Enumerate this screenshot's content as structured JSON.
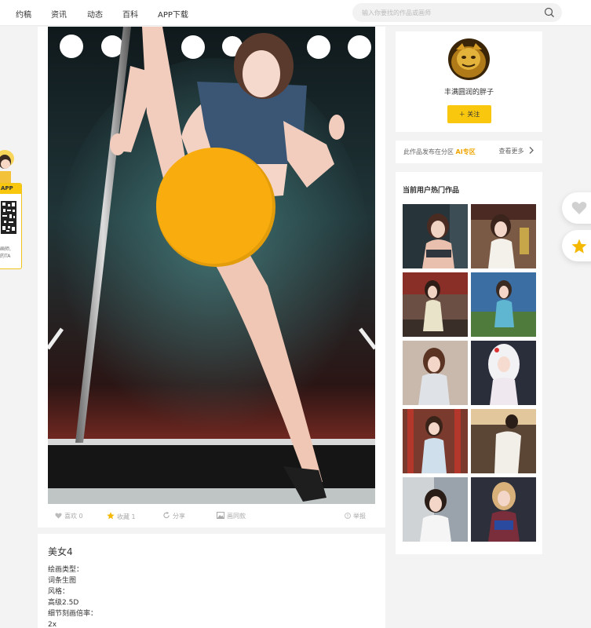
{
  "nav": {
    "items": [
      "约稿",
      "资讯",
      "动态",
      "百科",
      "APP下载"
    ]
  },
  "search": {
    "placeholder": "输入你要找的作品或画师"
  },
  "float_qr": {
    "label": "APP",
    "text_line1": "画师,",
    "text_line2": "的TA"
  },
  "artwork": {
    "censor_color": "#f9ac0e"
  },
  "actions": {
    "like": "喜欢 0",
    "collect": "收藏 1",
    "share": "分享",
    "same": "画同款",
    "report": "举报"
  },
  "description": {
    "title": "美女4",
    "lines": [
      "绘画类型：",
      "词条生图",
      "风格：",
      "高级2.5D",
      "细节刻画倍率：",
      "2x"
    ]
  },
  "author": {
    "name": "丰满圆润的胖子",
    "follow_label": "＋ 关注"
  },
  "zone": {
    "prefix": "此作品发布在分区",
    "zone_name": "AI专区",
    "more": "查看更多"
  },
  "hot": {
    "title": "当前用户热门作品"
  },
  "colors": {
    "accent": "#f9c80e",
    "zone_link": "#f0a500"
  },
  "icons": [
    "search-icon",
    "heart-icon",
    "star-icon",
    "share-icon",
    "image-icon",
    "report-icon",
    "chevron-right-icon"
  ]
}
